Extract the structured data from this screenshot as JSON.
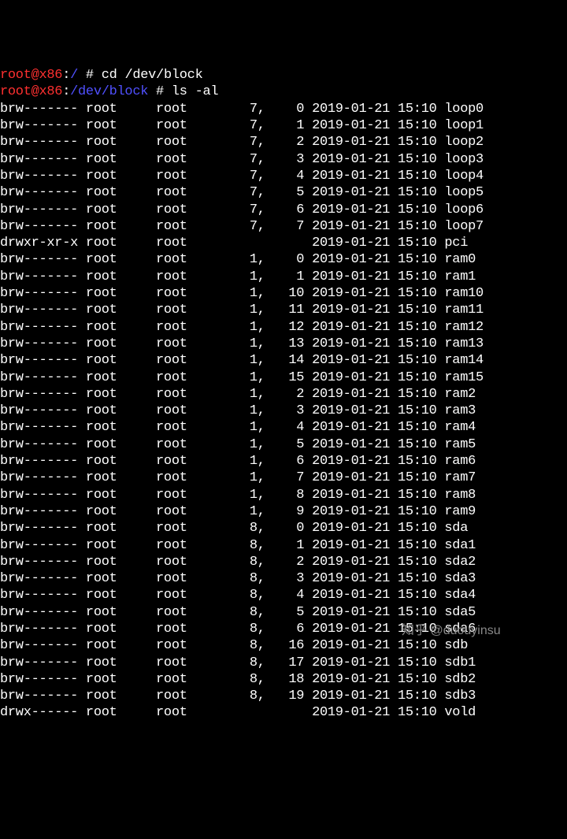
{
  "prompt1": {
    "user": "root@x86",
    "path": "/",
    "sep": " # ",
    "cmd": "cd /dev/block"
  },
  "prompt2": {
    "user": "root@x86",
    "path": "/dev/block",
    "sep": " # ",
    "cmd": "ls -al"
  },
  "rows": [
    {
      "perm": "brw-------",
      "owner": "root",
      "group": "root",
      "maj": "7,",
      "min": "0",
      "date": "2019-01-21",
      "time": "15:10",
      "name": "loop0"
    },
    {
      "perm": "brw-------",
      "owner": "root",
      "group": "root",
      "maj": "7,",
      "min": "1",
      "date": "2019-01-21",
      "time": "15:10",
      "name": "loop1"
    },
    {
      "perm": "brw-------",
      "owner": "root",
      "group": "root",
      "maj": "7,",
      "min": "2",
      "date": "2019-01-21",
      "time": "15:10",
      "name": "loop2"
    },
    {
      "perm": "brw-------",
      "owner": "root",
      "group": "root",
      "maj": "7,",
      "min": "3",
      "date": "2019-01-21",
      "time": "15:10",
      "name": "loop3"
    },
    {
      "perm": "brw-------",
      "owner": "root",
      "group": "root",
      "maj": "7,",
      "min": "4",
      "date": "2019-01-21",
      "time": "15:10",
      "name": "loop4"
    },
    {
      "perm": "brw-------",
      "owner": "root",
      "group": "root",
      "maj": "7,",
      "min": "5",
      "date": "2019-01-21",
      "time": "15:10",
      "name": "loop5"
    },
    {
      "perm": "brw-------",
      "owner": "root",
      "group": "root",
      "maj": "7,",
      "min": "6",
      "date": "2019-01-21",
      "time": "15:10",
      "name": "loop6"
    },
    {
      "perm": "brw-------",
      "owner": "root",
      "group": "root",
      "maj": "7,",
      "min": "7",
      "date": "2019-01-21",
      "time": "15:10",
      "name": "loop7"
    },
    {
      "perm": "drwxr-xr-x",
      "owner": "root",
      "group": "root",
      "maj": "",
      "min": "",
      "date": "2019-01-21",
      "time": "15:10",
      "name": "pci"
    },
    {
      "perm": "brw-------",
      "owner": "root",
      "group": "root",
      "maj": "1,",
      "min": "0",
      "date": "2019-01-21",
      "time": "15:10",
      "name": "ram0"
    },
    {
      "perm": "brw-------",
      "owner": "root",
      "group": "root",
      "maj": "1,",
      "min": "1",
      "date": "2019-01-21",
      "time": "15:10",
      "name": "ram1"
    },
    {
      "perm": "brw-------",
      "owner": "root",
      "group": "root",
      "maj": "1,",
      "min": "10",
      "date": "2019-01-21",
      "time": "15:10",
      "name": "ram10"
    },
    {
      "perm": "brw-------",
      "owner": "root",
      "group": "root",
      "maj": "1,",
      "min": "11",
      "date": "2019-01-21",
      "time": "15:10",
      "name": "ram11"
    },
    {
      "perm": "brw-------",
      "owner": "root",
      "group": "root",
      "maj": "1,",
      "min": "12",
      "date": "2019-01-21",
      "time": "15:10",
      "name": "ram12"
    },
    {
      "perm": "brw-------",
      "owner": "root",
      "group": "root",
      "maj": "1,",
      "min": "13",
      "date": "2019-01-21",
      "time": "15:10",
      "name": "ram13"
    },
    {
      "perm": "brw-------",
      "owner": "root",
      "group": "root",
      "maj": "1,",
      "min": "14",
      "date": "2019-01-21",
      "time": "15:10",
      "name": "ram14"
    },
    {
      "perm": "brw-------",
      "owner": "root",
      "group": "root",
      "maj": "1,",
      "min": "15",
      "date": "2019-01-21",
      "time": "15:10",
      "name": "ram15"
    },
    {
      "perm": "brw-------",
      "owner": "root",
      "group": "root",
      "maj": "1,",
      "min": "2",
      "date": "2019-01-21",
      "time": "15:10",
      "name": "ram2"
    },
    {
      "perm": "brw-------",
      "owner": "root",
      "group": "root",
      "maj": "1,",
      "min": "3",
      "date": "2019-01-21",
      "time": "15:10",
      "name": "ram3"
    },
    {
      "perm": "brw-------",
      "owner": "root",
      "group": "root",
      "maj": "1,",
      "min": "4",
      "date": "2019-01-21",
      "time": "15:10",
      "name": "ram4"
    },
    {
      "perm": "brw-------",
      "owner": "root",
      "group": "root",
      "maj": "1,",
      "min": "5",
      "date": "2019-01-21",
      "time": "15:10",
      "name": "ram5"
    },
    {
      "perm": "brw-------",
      "owner": "root",
      "group": "root",
      "maj": "1,",
      "min": "6",
      "date": "2019-01-21",
      "time": "15:10",
      "name": "ram6"
    },
    {
      "perm": "brw-------",
      "owner": "root",
      "group": "root",
      "maj": "1,",
      "min": "7",
      "date": "2019-01-21",
      "time": "15:10",
      "name": "ram7"
    },
    {
      "perm": "brw-------",
      "owner": "root",
      "group": "root",
      "maj": "1,",
      "min": "8",
      "date": "2019-01-21",
      "time": "15:10",
      "name": "ram8"
    },
    {
      "perm": "brw-------",
      "owner": "root",
      "group": "root",
      "maj": "1,",
      "min": "9",
      "date": "2019-01-21",
      "time": "15:10",
      "name": "ram9"
    },
    {
      "perm": "brw-------",
      "owner": "root",
      "group": "root",
      "maj": "8,",
      "min": "0",
      "date": "2019-01-21",
      "time": "15:10",
      "name": "sda"
    },
    {
      "perm": "brw-------",
      "owner": "root",
      "group": "root",
      "maj": "8,",
      "min": "1",
      "date": "2019-01-21",
      "time": "15:10",
      "name": "sda1"
    },
    {
      "perm": "brw-------",
      "owner": "root",
      "group": "root",
      "maj": "8,",
      "min": "2",
      "date": "2019-01-21",
      "time": "15:10",
      "name": "sda2"
    },
    {
      "perm": "brw-------",
      "owner": "root",
      "group": "root",
      "maj": "8,",
      "min": "3",
      "date": "2019-01-21",
      "time": "15:10",
      "name": "sda3"
    },
    {
      "perm": "brw-------",
      "owner": "root",
      "group": "root",
      "maj": "8,",
      "min": "4",
      "date": "2019-01-21",
      "time": "15:10",
      "name": "sda4"
    },
    {
      "perm": "brw-------",
      "owner": "root",
      "group": "root",
      "maj": "8,",
      "min": "5",
      "date": "2019-01-21",
      "time": "15:10",
      "name": "sda5"
    },
    {
      "perm": "brw-------",
      "owner": "root",
      "group": "root",
      "maj": "8,",
      "min": "6",
      "date": "2019-01-21",
      "time": "15:10",
      "name": "sda6"
    },
    {
      "perm": "brw-------",
      "owner": "root",
      "group": "root",
      "maj": "8,",
      "min": "16",
      "date": "2019-01-21",
      "time": "15:10",
      "name": "sdb"
    },
    {
      "perm": "brw-------",
      "owner": "root",
      "group": "root",
      "maj": "8,",
      "min": "17",
      "date": "2019-01-21",
      "time": "15:10",
      "name": "sdb1"
    },
    {
      "perm": "brw-------",
      "owner": "root",
      "group": "root",
      "maj": "8,",
      "min": "18",
      "date": "2019-01-21",
      "time": "15:10",
      "name": "sdb2"
    },
    {
      "perm": "brw-------",
      "owner": "root",
      "group": "root",
      "maj": "8,",
      "min": "19",
      "date": "2019-01-21",
      "time": "15:10",
      "name": "sdb3"
    },
    {
      "perm": "drwx------",
      "owner": "root",
      "group": "root",
      "maj": "",
      "min": "",
      "date": "2019-01-21",
      "time": "15:10",
      "name": "vold"
    }
  ],
  "watermark": "知乎 @duouyinsu"
}
